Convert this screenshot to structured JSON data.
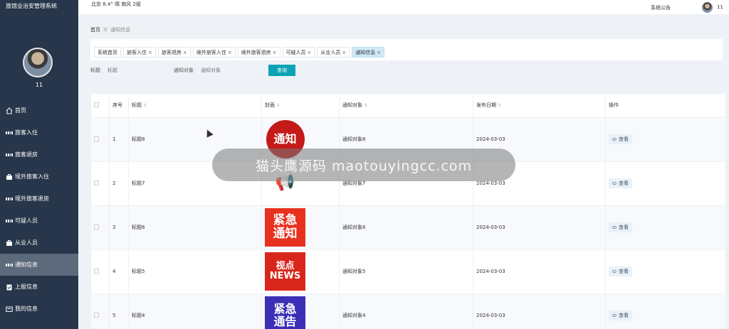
{
  "app": {
    "title": "旅馆业治安管理系统"
  },
  "sidebar": {
    "username": "11",
    "items": [
      {
        "label": "首页",
        "icon": "home-icon",
        "active": false
      },
      {
        "label": "旅客入住",
        "icon": "grid-icon",
        "active": false
      },
      {
        "label": "旅客退房",
        "icon": "grid-icon",
        "active": false
      },
      {
        "label": "境外旅客入住",
        "icon": "briefcase-icon",
        "active": false
      },
      {
        "label": "境外旅客退房",
        "icon": "grid-icon",
        "active": false
      },
      {
        "label": "可疑人员",
        "icon": "grid-icon",
        "active": false
      },
      {
        "label": "从业人员",
        "icon": "briefcase-icon",
        "active": false
      },
      {
        "label": "通知信息",
        "icon": "grid-icon",
        "active": true
      },
      {
        "label": "上报信息",
        "icon": "clipboard-icon",
        "active": false
      },
      {
        "label": "我的信息",
        "icon": "card-icon",
        "active": false
      }
    ]
  },
  "topbar": {
    "weather": "北京  8.4°  晴  南风  2级",
    "notice": "系统公告",
    "username": "11"
  },
  "breadcrumb": {
    "home": "首页",
    "sep": "☰",
    "current": "通知信息"
  },
  "tabs": [
    {
      "label": "系统首页",
      "closable": false,
      "active": false
    },
    {
      "label": "旅客入住",
      "closable": true,
      "active": false
    },
    {
      "label": "旅客退房",
      "closable": true,
      "active": false
    },
    {
      "label": "境外旅客入住",
      "closable": true,
      "active": false
    },
    {
      "label": "境外旅客退房",
      "closable": true,
      "active": false
    },
    {
      "label": "可疑人员",
      "closable": true,
      "active": false
    },
    {
      "label": "从业人员",
      "closable": true,
      "active": false
    },
    {
      "label": "通知信息",
      "closable": true,
      "active": true
    }
  ],
  "search": {
    "title_label": "标题",
    "title_placeholder": "标题",
    "target_label": "通知对象",
    "target_placeholder": "通知对象",
    "query_button": "查询"
  },
  "table": {
    "headers": {
      "index": "序号",
      "title": "标题",
      "cover": "封面",
      "target": "通知对象",
      "date": "发布日期",
      "action": "操作"
    },
    "sort_glyph": "⇕",
    "view_label": "查看",
    "rows": [
      {
        "index": "1",
        "title": "标题8",
        "target": "通知对象8",
        "date": "2024-03-03",
        "cover_text": "通知",
        "cover_color": "#c41a1a"
      },
      {
        "index": "2",
        "title": "标题7",
        "target": "通知对象7",
        "date": "2024-03-03",
        "cover_text": "📢",
        "cover_color": "#ffffff"
      },
      {
        "index": "3",
        "title": "标题6",
        "target": "通知对象6",
        "date": "2024-03-03",
        "cover_text": "紧急通知",
        "cover_color": "#e8301f"
      },
      {
        "index": "4",
        "title": "标题5",
        "target": "通知对象5",
        "date": "2024-03-03",
        "cover_text": "视点 NEWS",
        "cover_color": "#d9261c"
      },
      {
        "index": "5",
        "title": "标题4",
        "target": "通知对象4",
        "date": "2024-03-03",
        "cover_text": "紧急通告",
        "cover_color": "#3b2fb8"
      }
    ]
  },
  "overlay": {
    "banner_text": "猫头鹰源码 maotouyingcc.com"
  }
}
